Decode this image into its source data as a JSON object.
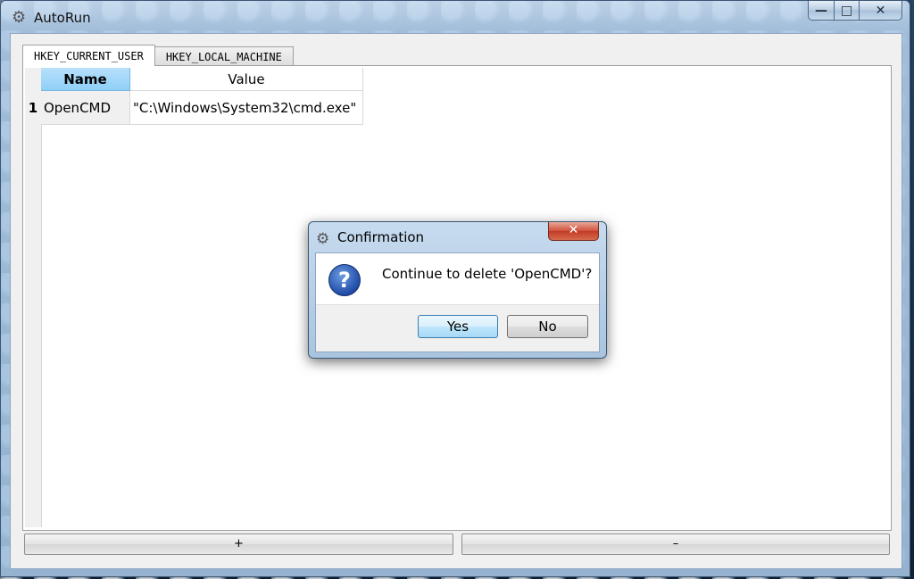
{
  "window": {
    "title": "AutoRun",
    "minimize_glyph": "—",
    "maximize_glyph": "□",
    "close_glyph": "✕"
  },
  "tabs": [
    {
      "label": "HKEY_CURRENT_USER",
      "active": true
    },
    {
      "label": "HKEY_LOCAL_MACHINE",
      "active": false
    }
  ],
  "table": {
    "columns": [
      "Name",
      "Value"
    ],
    "rows": [
      {
        "index": "1",
        "name": "OpenCMD",
        "value": "\"C:\\Windows\\System32\\cmd.exe\""
      }
    ]
  },
  "buttons": {
    "add_label": "+",
    "remove_label": "–"
  },
  "dialog": {
    "title": "Confirmation",
    "close_glyph": "✕",
    "message": "Continue to delete 'OpenCMD'?",
    "icon_glyph": "?",
    "yes_label": "Yes",
    "no_label": "No"
  },
  "icons": {
    "app": "gear-icon",
    "dialog_type": "question-icon"
  }
}
